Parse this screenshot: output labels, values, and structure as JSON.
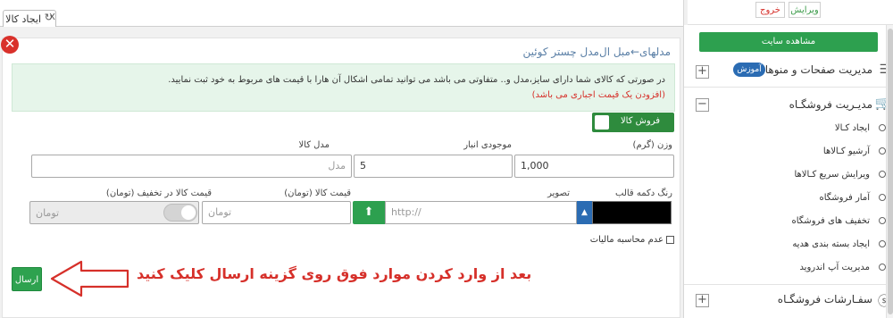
{
  "tab": {
    "label": "ایجاد کالا",
    "close": "X",
    "refresh_icon": "refresh-icon"
  },
  "breadcrumb": "مدلهای←مبل ال‌مدل چستر کوئین",
  "notice": {
    "line1": "در صورتی که کالای شما دارای سایز،مدل و.. متفاوتی می باشد می توانید تمامی اشکال آن هارا با قیمت های مربوط به خود ثبت نمایید.",
    "line2": "(افزودن یک قیمت اجباری می باشد)"
  },
  "sale_toggle": {
    "label": "فروش کالا",
    "state": "on"
  },
  "fields": {
    "weight": {
      "label": "وزن (گرم)",
      "value": "1,000"
    },
    "stock": {
      "label": "موجودی انبار",
      "value": "5"
    },
    "model": {
      "label": "مدل کالا",
      "placeholder": "مدل"
    },
    "button_color": {
      "label": "رنگ دکمه قالب",
      "value": "#000000"
    },
    "image": {
      "label": "تصویر",
      "placeholder": "http://"
    },
    "price": {
      "label": "قیمت کالا (تومان)",
      "placeholder": "تومان"
    },
    "discount_price": {
      "label": "قیمت کالا در تخفیف (تومان)",
      "placeholder": "تومان",
      "toggle_state": "off"
    }
  },
  "tax": {
    "label": "عدم محاسبه مالیات",
    "checked": false
  },
  "submit": {
    "label": "ارسال"
  },
  "instruction": "بعد از وارد کردن موارد فوق روی گزینه ارسال کلیک کنید",
  "colors": {
    "accent_green": "#2da04f",
    "alert_red": "#d6302a",
    "link_blue": "#2b6cb3",
    "notice_bg": "#e6f5ea"
  },
  "sidebar": {
    "edit": "ویرایش",
    "logout": "خروج",
    "view_site": "مشاهده سایت",
    "pages_menus": {
      "label": "مدیریت صفحات و منوها",
      "badge": "آموزش",
      "icon": "list-icon",
      "toggle": "+"
    },
    "store": {
      "label": "مدیـریت فروشگـاه",
      "icon": "cart-icon",
      "toggle": "−",
      "items": [
        "ایجاد کـالا",
        "آرشیو کـالاها",
        "ویرایش سریع کـالاها",
        "آمار فروشگاه",
        "تخفیف های فروشگاه",
        "ایجاد بسته بندی هدیه",
        "مدیریت آپ اندروید"
      ]
    },
    "orders": {
      "label": "سفـارشات فروشگـاه",
      "icon": "dollar-icon",
      "toggle": "+"
    }
  }
}
